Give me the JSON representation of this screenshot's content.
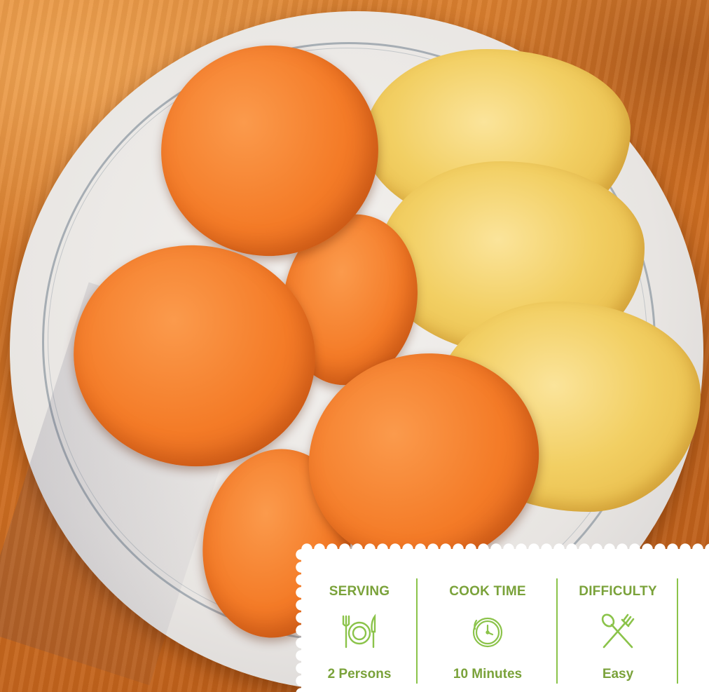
{
  "info_card": {
    "items": [
      {
        "label": "SERVING",
        "icon": "plate-cutlery-icon",
        "value": "2 Persons"
      },
      {
        "label": "COOK TIME",
        "icon": "clock-icon",
        "value": "10 Minutes"
      },
      {
        "label": "DIFFICULTY",
        "icon": "crossed-fork-spoon-icon",
        "value": "Easy"
      }
    ],
    "accent_color": "#7aa23a",
    "divider_color": "#8bc34a"
  }
}
